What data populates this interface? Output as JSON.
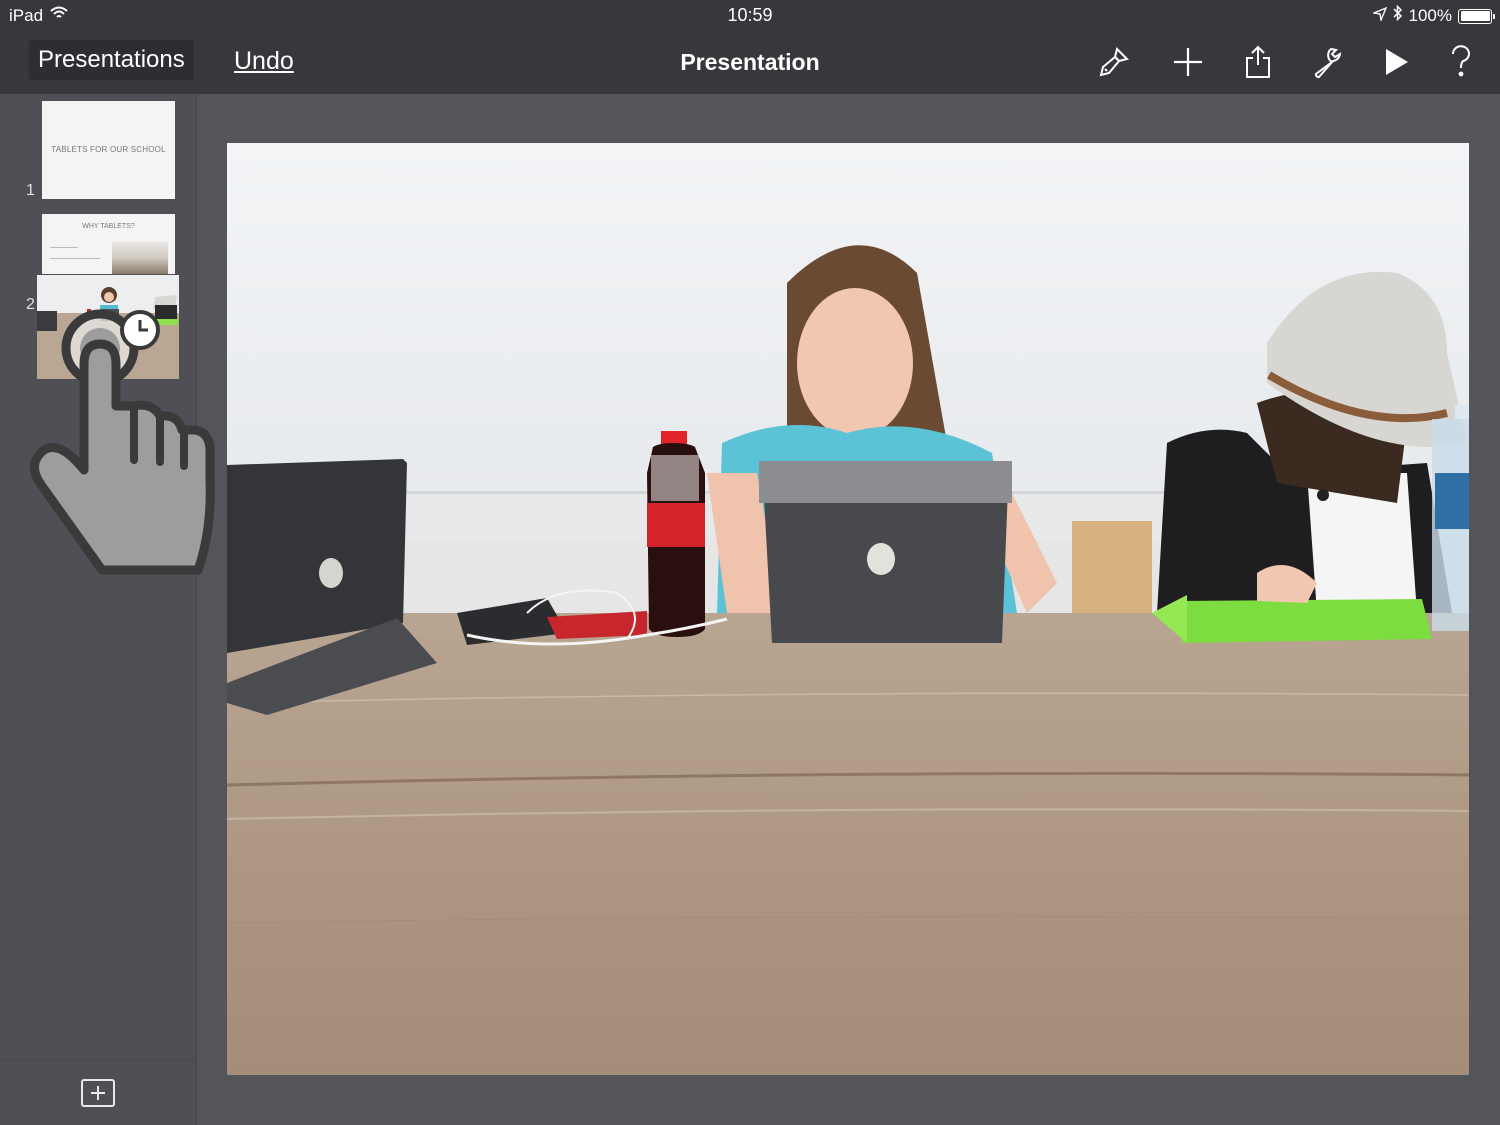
{
  "status_bar": {
    "device": "iPad",
    "time": "10:59",
    "battery_text": "100%",
    "battery_level": 1.0
  },
  "toolbar": {
    "presentations_label": "Presentations",
    "undo_label": "Undo",
    "title": "Presentation",
    "icons": [
      "paintbrush-icon",
      "plus-icon",
      "share-icon",
      "wrench-icon",
      "play-icon",
      "help-icon"
    ]
  },
  "slides": [
    {
      "number": "1",
      "title": "TABLETS FOR OUR SCHOOL"
    },
    {
      "number": "2",
      "title": "WHY TABLETS?"
    }
  ],
  "colors": {
    "toolbar_bg": "#36383b",
    "sidebar_bg": "#4e5055",
    "workspace_bg": "#53555a",
    "table_wood": "#b59f8a",
    "wall": "#eef0f2"
  }
}
